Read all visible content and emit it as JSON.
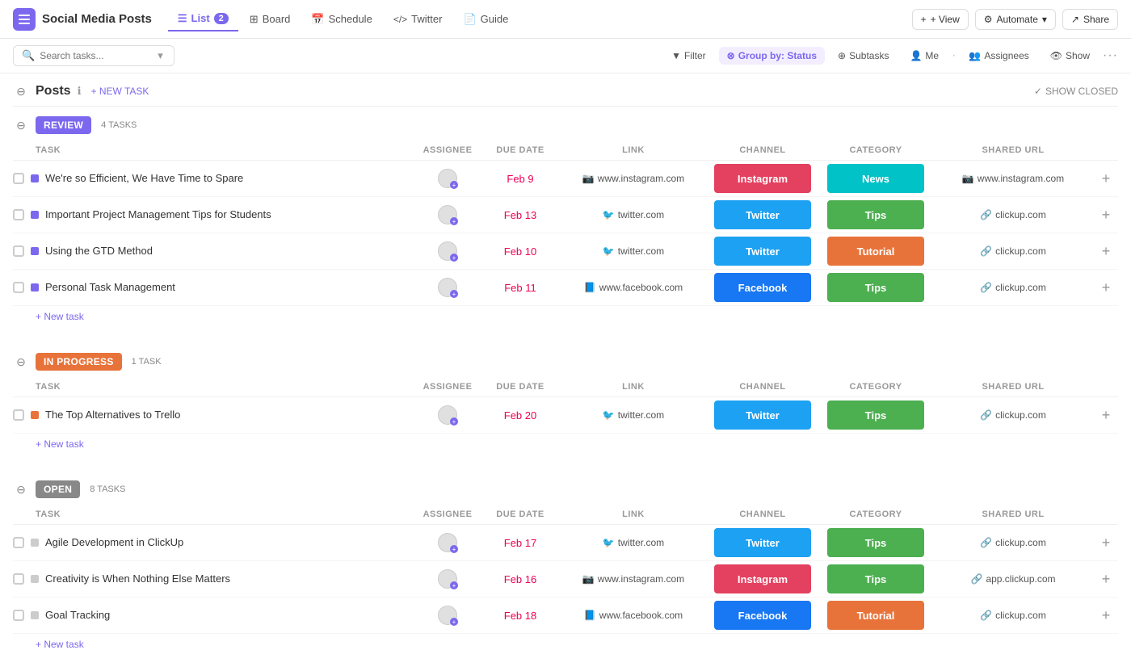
{
  "app": {
    "icon": "☰",
    "project_title": "Social Media Posts"
  },
  "nav": {
    "tabs": [
      {
        "id": "list",
        "label": "List",
        "icon": "☰",
        "active": true,
        "count": "2"
      },
      {
        "id": "board",
        "label": "Board",
        "icon": "⊞",
        "active": false
      },
      {
        "id": "schedule",
        "label": "Schedule",
        "icon": "📅",
        "active": false
      },
      {
        "id": "twitter",
        "label": "Twitter",
        "icon": "</>",
        "active": false
      },
      {
        "id": "guide",
        "label": "Guide",
        "icon": "📄",
        "active": false
      }
    ],
    "view_label": "+ View",
    "automate_label": "Automate",
    "share_label": "Share"
  },
  "toolbar": {
    "search_placeholder": "Search tasks...",
    "filter_label": "Filter",
    "group_by_label": "Group by: Status",
    "subtasks_label": "Subtasks",
    "me_label": "Me",
    "assignees_label": "Assignees",
    "show_label": "Show"
  },
  "posts_section": {
    "title": "Posts",
    "new_task_label": "+ NEW TASK",
    "show_closed_label": "SHOW CLOSED"
  },
  "col_headers": {
    "task": "TASK",
    "assignee": "ASSIGNEE",
    "due_date": "DUE DATE",
    "link": "LINK",
    "channel": "CHANNEL",
    "category": "CATEGORY",
    "shared_url": "SHARED URL"
  },
  "review_group": {
    "status_label": "REVIEW",
    "task_count": "4 TASKS",
    "tasks": [
      {
        "name": "We're so Efficient, We Have Time to Spare",
        "date": "Feb 9",
        "link_icon": "instagram",
        "link_url": "www.instagram.com",
        "channel": "Instagram",
        "channel_type": "instagram",
        "category": "News",
        "category_type": "news",
        "shared_url": "www.instagram.com",
        "shared_icon": "instagram"
      },
      {
        "name": "Important Project Management Tips for Students",
        "date": "Feb 13",
        "link_icon": "twitter",
        "link_url": "twitter.com",
        "channel": "Twitter",
        "channel_type": "twitter",
        "category": "Tips",
        "category_type": "tips",
        "shared_url": "clickup.com",
        "shared_icon": "clickup"
      },
      {
        "name": "Using the GTD Method",
        "date": "Feb 10",
        "link_icon": "twitter",
        "link_url": "twitter.com",
        "channel": "Twitter",
        "channel_type": "twitter",
        "category": "Tutorial",
        "category_type": "tutorial",
        "shared_url": "clickup.com",
        "shared_icon": "clickup"
      },
      {
        "name": "Personal Task Management",
        "date": "Feb 11",
        "link_icon": "facebook",
        "link_url": "www.facebook.com",
        "channel": "Facebook",
        "channel_type": "facebook",
        "category": "Tips",
        "category_type": "tips",
        "shared_url": "clickup.com",
        "shared_icon": "clickup"
      }
    ],
    "new_task_label": "+ New task"
  },
  "inprogress_group": {
    "status_label": "IN PROGRESS",
    "task_count": "1 TASK",
    "tasks": [
      {
        "name": "The Top Alternatives to Trello",
        "date": "Feb 20",
        "link_icon": "twitter",
        "link_url": "twitter.com",
        "channel": "Twitter",
        "channel_type": "twitter",
        "category": "Tips",
        "category_type": "tips",
        "shared_url": "clickup.com",
        "shared_icon": "clickup"
      }
    ],
    "new_task_label": "+ New task"
  },
  "open_group": {
    "status_label": "OPEN",
    "task_count": "8 TASKS",
    "tasks": [
      {
        "name": "Agile Development in ClickUp",
        "date": "Feb 17",
        "link_icon": "twitter",
        "link_url": "twitter.com",
        "channel": "Twitter",
        "channel_type": "twitter",
        "category": "Tips",
        "category_type": "tips",
        "shared_url": "clickup.com",
        "shared_icon": "clickup"
      },
      {
        "name": "Creativity is When Nothing Else Matters",
        "date": "Feb 16",
        "link_icon": "instagram",
        "link_url": "www.instagram.com",
        "channel": "Instagram",
        "channel_type": "instagram",
        "category": "Tips",
        "category_type": "tips",
        "shared_url": "app.clickup.com",
        "shared_icon": "clickup"
      },
      {
        "name": "Goal Tracking",
        "date": "Feb 18",
        "link_icon": "facebook",
        "link_url": "www.facebook.com",
        "channel": "Facebook",
        "channel_type": "facebook",
        "category": "Tutorial",
        "category_type": "tutorial",
        "shared_url": "clickup.com",
        "shared_icon": "clickup"
      }
    ],
    "new_task_label": "+ New task"
  }
}
